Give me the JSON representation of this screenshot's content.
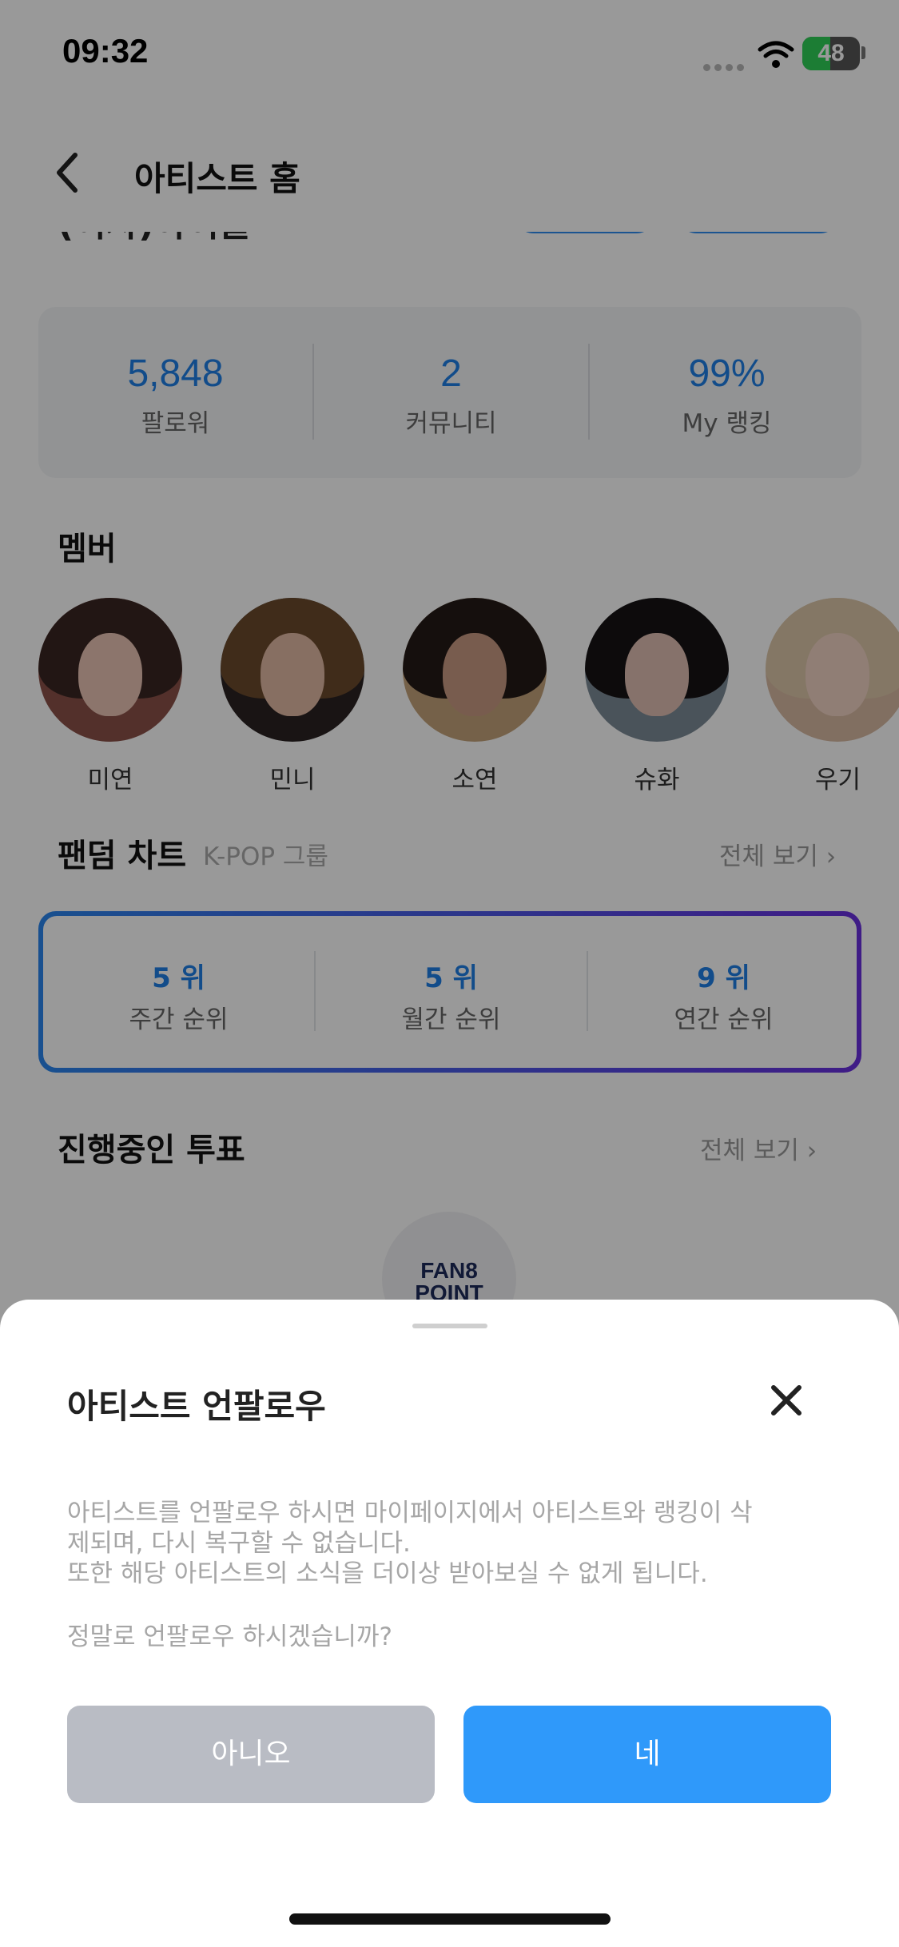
{
  "status_bar": {
    "time": "09:32",
    "battery": "48",
    "battery_level_percent": 48
  },
  "header": {
    "title": "아티스트 홈"
  },
  "stats": [
    {
      "value": "5,848",
      "label": "팔로워"
    },
    {
      "value": "2",
      "label": "커뮤니티"
    },
    {
      "value": "99%",
      "label": "My 랭킹"
    }
  ],
  "members_section": {
    "title": "멤버",
    "members": [
      {
        "name": "미연",
        "hair_color": "#3a2622",
        "skin_color": "#e9c3b4",
        "bg_color": "#8a5048"
      },
      {
        "name": "민니",
        "hair_color": "#6b4a2c",
        "skin_color": "#e2b9a3",
        "bg_color": "#2a2222"
      },
      {
        "name": "소연",
        "hair_color": "#241a17",
        "skin_color": "#c99a83",
        "bg_color": "#c4a27a"
      },
      {
        "name": "슈화",
        "hair_color": "#171314",
        "skin_color": "#e0bfb2",
        "bg_color": "#7c8a96"
      },
      {
        "name": "우기",
        "hair_color": "#dcc7a8",
        "skin_color": "#f0d2c4",
        "bg_color": "#d8b9a2"
      }
    ]
  },
  "fandom_chart": {
    "title": "팬덤 차트",
    "subtitle": "K-POP 그룹",
    "view_all": "전체 보기 ›",
    "ranks": [
      {
        "value": "5 위",
        "label": "주간 순위"
      },
      {
        "value": "5 위",
        "label": "월간 순위"
      },
      {
        "value": "9 위",
        "label": "연간 순위"
      }
    ]
  },
  "votes_section": {
    "title": "진행중인 투표",
    "view_all": "전체 보기 ›",
    "badge_line1": "FAN8",
    "badge_line2": "POINT"
  },
  "sheet": {
    "title": "아티스트 언팔로우",
    "message_line1": "아티스트를 언팔로우 하시면 마이페이지에서 아티스트와 랭킹이 삭",
    "message_line2": "제되며, 다시 복구할 수 없습니다.",
    "message_line3": "또한 해당 아티스트의 소식을 더이상 받아보실 수 없게 됩니다.",
    "question": "정말로 언팔로우 하시겠습니까?",
    "no_label": "아니오",
    "yes_label": "네"
  }
}
